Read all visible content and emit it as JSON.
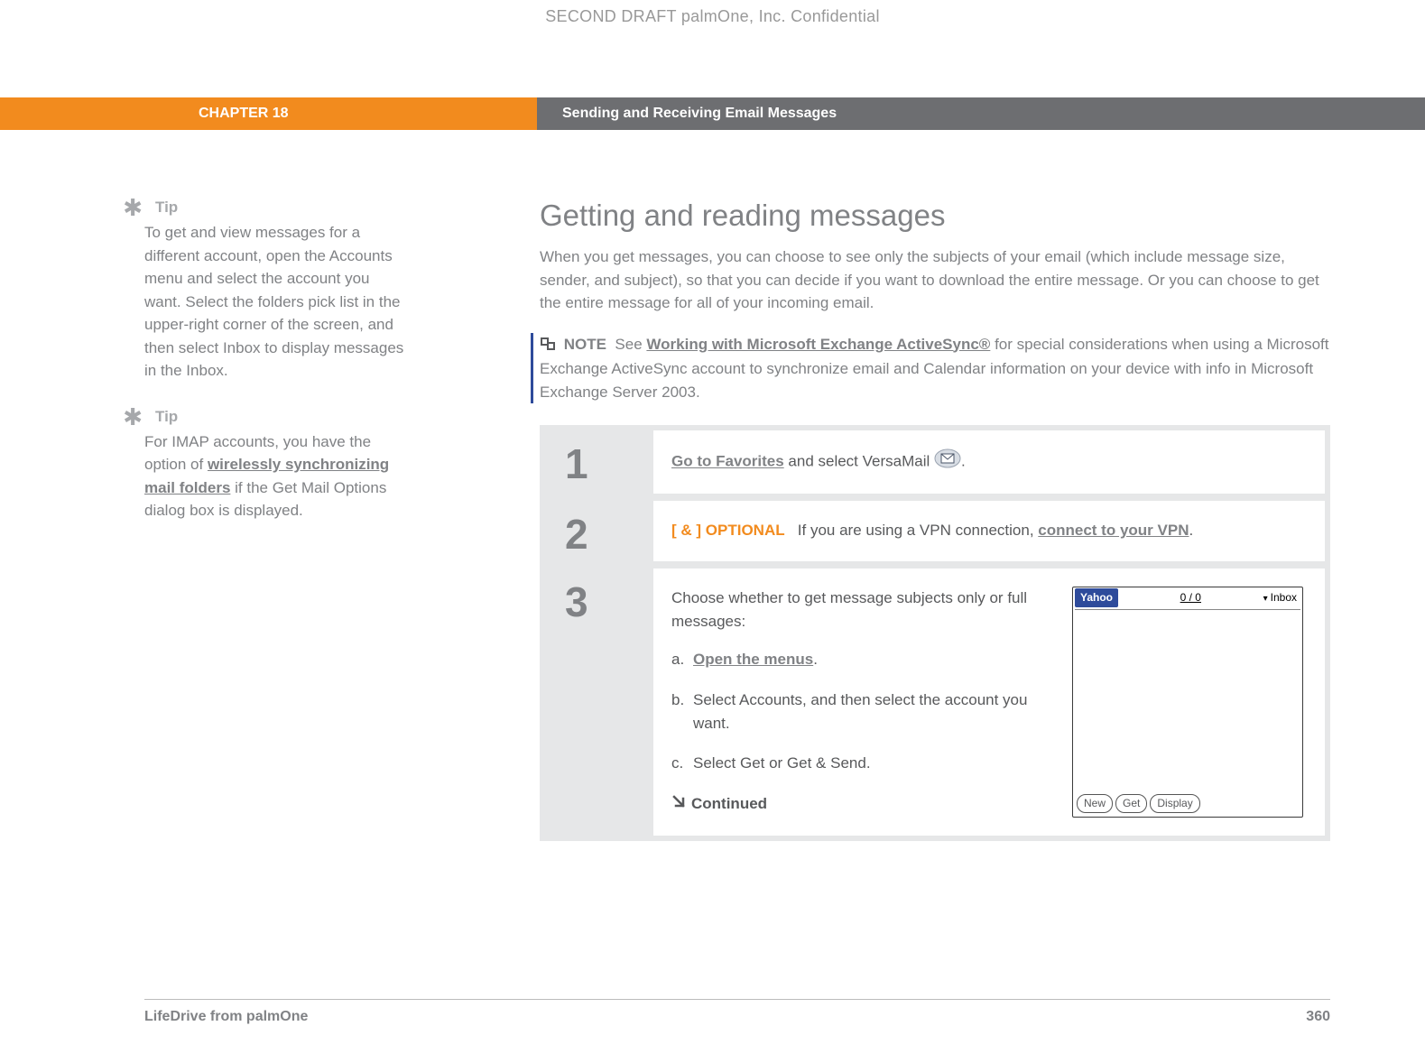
{
  "watermark": "SECOND DRAFT palmOne, Inc.  Confidential",
  "chapter": "CHAPTER 18",
  "chapter_title": "Sending and Receiving Email Messages",
  "tips": [
    {
      "label": "Tip",
      "body": "To get and view messages for a different account, open the Accounts menu and select the account you want. Select the folders pick list in the upper-right corner of the screen, and then select Inbox to display messages in the Inbox."
    },
    {
      "label": "Tip",
      "body_pre": "For IMAP accounts, you have the option of ",
      "link": "wirelessly synchronizing mail folders",
      "body_post": " if the Get Mail Options dialog box is displayed."
    }
  ],
  "heading": "Getting and reading messages",
  "intro": "When you get messages, you can choose to see only the subjects of your email (which include message size, sender, and subject), so that you can decide if you want to download the entire message. Or you can choose to get the entire message for all of your incoming email.",
  "note": {
    "label": "NOTE",
    "pre": "See ",
    "link": "Working with Microsoft Exchange ActiveSync®",
    "post": " for special considerations when using a Microsoft Exchange ActiveSync account to synchronize email and Calendar information on your device with info in Microsoft Exchange Server 2003."
  },
  "steps": {
    "s1": {
      "num": "1",
      "link": "Go to Favorites",
      "post": " and select VersaMail ",
      "end": "."
    },
    "s2": {
      "num": "2",
      "optional": "[ & ] OPTIONAL",
      "pre": "If you are using a VPN connection, ",
      "link": "connect to your VPN",
      "end": "."
    },
    "s3": {
      "num": "3",
      "lead": "Choose whether to get message subjects only or full messages:",
      "a_letter": "a.",
      "a_link": "Open the menus",
      "a_end": ".",
      "b_letter": "b.",
      "b": "Select Accounts, and then select the account you want.",
      "c_letter": "c.",
      "c": "Select Get or Get & Send.",
      "continued": "Continued"
    }
  },
  "device": {
    "account": "Yahoo",
    "count": "0 / 0",
    "folder": "Inbox",
    "buttons": [
      "New",
      "Get",
      "Display"
    ]
  },
  "footer": {
    "product": "LifeDrive from palmOne",
    "page": "360"
  }
}
